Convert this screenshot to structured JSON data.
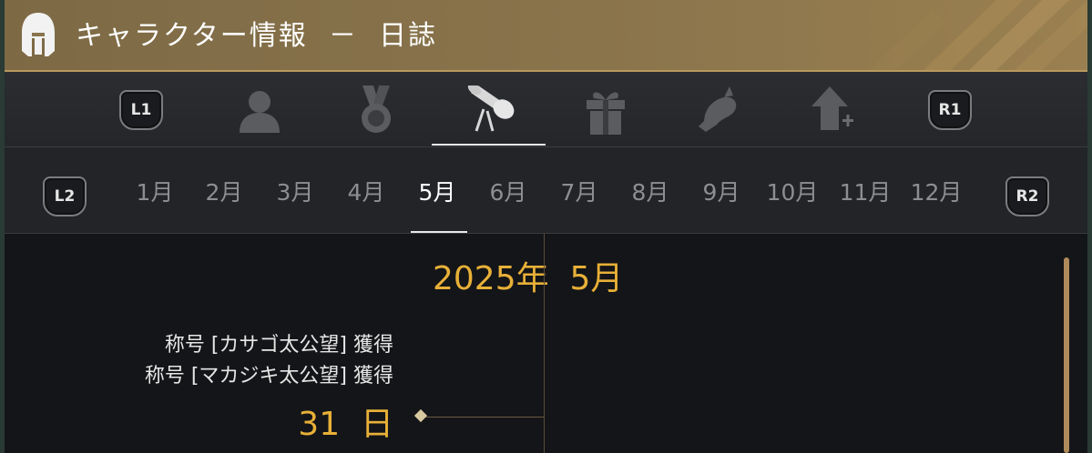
{
  "window": {
    "title": "キャラクター情報  －  日誌",
    "title_icon": "helmet-icon"
  },
  "tabs": {
    "left_button": "L1",
    "right_button": "R1",
    "items": [
      {
        "icon": "person-icon"
      },
      {
        "icon": "medal-icon"
      },
      {
        "icon": "scroll-icon",
        "active": true
      },
      {
        "icon": "gift-icon"
      },
      {
        "icon": "fish-icon"
      },
      {
        "icon": "level-up-icon"
      }
    ]
  },
  "months": {
    "left_button": "L2",
    "right_button": "R2",
    "items": [
      "1月",
      "2月",
      "3月",
      "4月",
      "5月",
      "6月",
      "7月",
      "8月",
      "9月",
      "10月",
      "11月",
      "12月"
    ],
    "selected": "5月"
  },
  "journal": {
    "heading": "2025年  5月",
    "entries": [
      {
        "day": "31  日",
        "events": [
          "称号 [カサゴ太公望] 獲得",
          "称号 [マカジキ太公望] 獲得"
        ]
      }
    ]
  },
  "colors": {
    "accent_gold": "#e8b038",
    "title_bar": "#8a744c"
  }
}
